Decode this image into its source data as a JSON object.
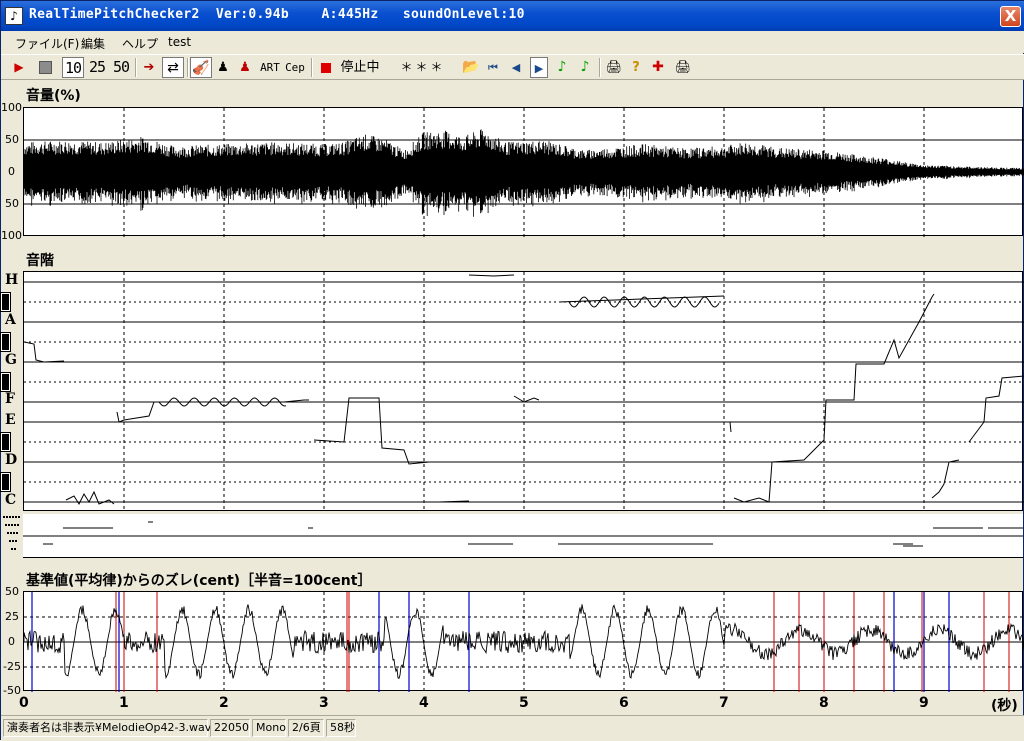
{
  "window": {
    "title": "RealTimePitchChecker2  Ver:0.94b    A:445Hz   soundOnLevel:10",
    "close": "X"
  },
  "menu": [
    "ファイル(F)",
    "編集",
    "ヘルプ",
    "test"
  ],
  "toolbar": {
    "speeds": [
      "10",
      "25",
      "50"
    ],
    "art": "ART",
    "cep": "Cep",
    "status": "停止中",
    "note_display": "＊＊＊"
  },
  "volume_panel": {
    "label": "音量(%)",
    "yticks": [
      "100",
      "50",
      "0",
      "50",
      "100"
    ]
  },
  "scale_panel": {
    "label": "音階",
    "notes": [
      "H",
      "A",
      "G",
      "F",
      "E",
      "D",
      "C"
    ]
  },
  "cent_panel": {
    "label": "基準値(平均律)からのズレ(cent)［半音=100cent］",
    "yticks": [
      "50",
      "25",
      "0",
      "-25",
      "-50"
    ]
  },
  "xaxis": {
    "ticks": [
      "0",
      "1",
      "2",
      "3",
      "4",
      "5",
      "6",
      "7",
      "8",
      "9"
    ],
    "unit": "(秒)"
  },
  "statusbar": [
    "演奏者名は非表示¥MelodieOp42-3.wav",
    "22050",
    "Mono",
    "2/6頁",
    "58秒"
  ],
  "colors": {
    "title_bar": "#0a50d0",
    "red_marker": "#cc0000",
    "blue_marker": "#0000cc"
  }
}
